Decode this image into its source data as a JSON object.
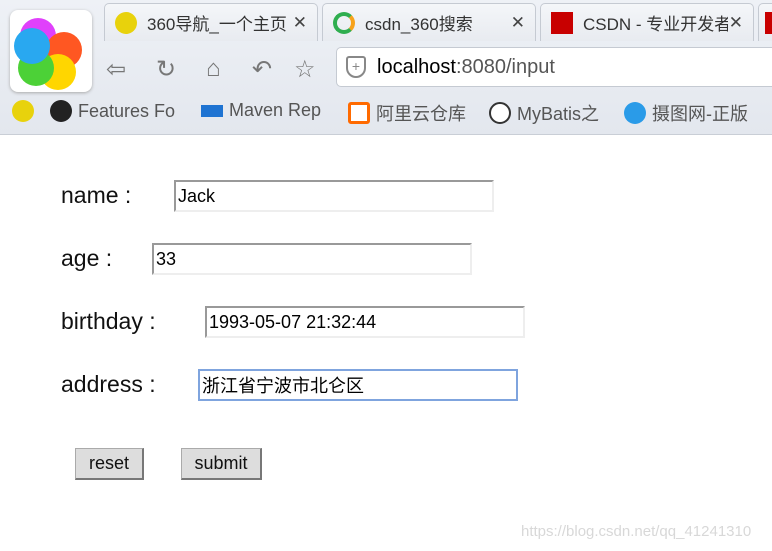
{
  "browser": {
    "tabs": [
      {
        "label": "360导航_一个主页",
        "icon": "360-nav-icon",
        "color": "#e8d20c"
      },
      {
        "label": "csdn_360搜索",
        "icon": "360-search-icon",
        "color": "#2fae4f"
      },
      {
        "label": "CSDN - 专业开发者",
        "icon": "csdn-icon",
        "color": "#c80000"
      }
    ],
    "address": {
      "host": "localhost",
      "rest": ":8080/input"
    },
    "bookmarks": [
      {
        "label": "Features Fo",
        "icon": "github-icon"
      },
      {
        "label": "Maven Rep",
        "icon": "maven-icon"
      },
      {
        "label": "阿里云仓库",
        "icon": "aliyun-icon"
      },
      {
        "label": "MyBatis之",
        "icon": "mybatis-icon"
      },
      {
        "label": "摄图网-正版",
        "icon": "sheTu-icon"
      }
    ]
  },
  "form": {
    "name_label": "name :",
    "name_value": "Jack",
    "age_label": "age :",
    "age_value": "33",
    "birthday_label": "birthday :",
    "birthday_value": "1993-05-07 21:32:44",
    "address_label": "address :",
    "address_value": "浙江省宁波市北仑区",
    "reset_label": "reset",
    "submit_label": "submit"
  },
  "watermark": "https://blog.csdn.net/qq_41241310"
}
